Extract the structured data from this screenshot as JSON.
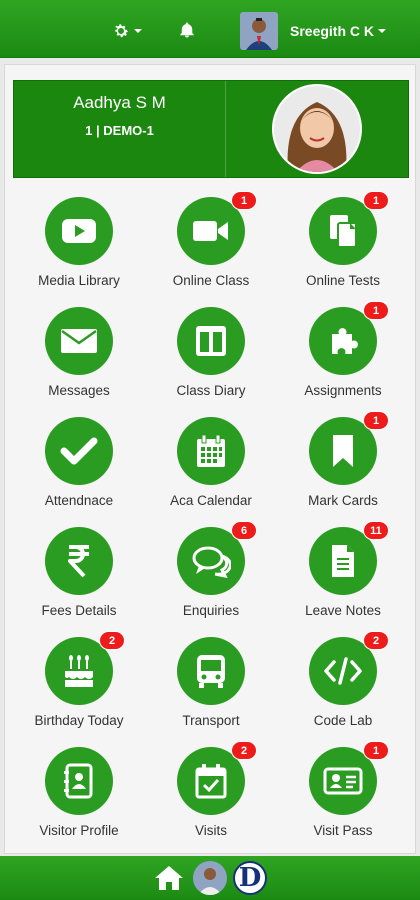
{
  "header": {
    "user_name": "Sreegith C K",
    "icons": [
      "gear-icon",
      "bell-icon"
    ]
  },
  "profile": {
    "student_name": "Aadhya S M",
    "class_info": "1 | DEMO-1"
  },
  "tiles": [
    {
      "label": "Media Library",
      "icon": "youtube-icon",
      "badge": ""
    },
    {
      "label": "Online Class",
      "icon": "video-camera-icon",
      "badge": "1"
    },
    {
      "label": "Online Tests",
      "icon": "copy-icon",
      "badge": "1"
    },
    {
      "label": "Messages",
      "icon": "envelope-icon",
      "badge": ""
    },
    {
      "label": "Class Diary",
      "icon": "columns-icon",
      "badge": ""
    },
    {
      "label": "Assignments",
      "icon": "puzzle-icon",
      "badge": "1"
    },
    {
      "label": "Attendnace",
      "icon": "check-icon",
      "badge": ""
    },
    {
      "label": "Aca Calendar",
      "icon": "calendar-icon",
      "badge": ""
    },
    {
      "label": "Mark Cards",
      "icon": "bookmark-icon",
      "badge": "1"
    },
    {
      "label": "Fees Details",
      "icon": "rupee-icon",
      "badge": ""
    },
    {
      "label": "Enquiries",
      "icon": "comments-icon",
      "badge": "6"
    },
    {
      "label": "Leave Notes",
      "icon": "document-icon",
      "badge": "11"
    },
    {
      "label": "Birthday Today",
      "icon": "birthday-cake-icon",
      "badge": "2"
    },
    {
      "label": "Transport",
      "icon": "bus-icon",
      "badge": ""
    },
    {
      "label": "Code Lab",
      "icon": "code-icon",
      "badge": "2"
    },
    {
      "label": "Visitor Profile",
      "icon": "address-book-icon",
      "badge": ""
    },
    {
      "label": "Visits",
      "icon": "calendar-check-icon",
      "badge": "2"
    },
    {
      "label": "Visit Pass",
      "icon": "id-card-icon",
      "badge": "1"
    }
  ],
  "footer": {
    "logo_letter": "D",
    "icons": [
      "home-icon"
    ]
  },
  "colors": {
    "primary_green": "#2b9c22",
    "badge_red": "#ee1b1b"
  }
}
